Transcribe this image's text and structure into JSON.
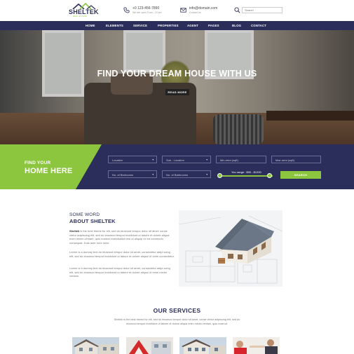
{
  "brand": {
    "name": "SHELTEK",
    "tagline": "REAL ESTATE"
  },
  "header": {
    "phone": {
      "number": "+0 123-456-7890",
      "hours": "We are open 9 am - 10 pm"
    },
    "email": {
      "address": "info@domain.com",
      "note": "Contact us"
    },
    "search_placeholder": "Search"
  },
  "nav": [
    "HOME",
    "ELEMENTS",
    "SERVICE",
    "PROPERTIES",
    "AGENT",
    "PAGES",
    "BLOG",
    "CONTACT"
  ],
  "hero": {
    "title": "FIND YOUR DREAM HOUSE WITH US",
    "button": "READ MORE"
  },
  "find": {
    "title_small": "FIND YOUR",
    "title_big": "HOME HERE",
    "location": "Location",
    "sub_location": "Sub - Location",
    "min_area": "Min area (sqft)",
    "max_area": "Max area (sqft)",
    "bedrooms": "No. of Bedrooms",
    "bathrooms": "No. of Bathrooms",
    "range_label": "You range : $90 - $1200",
    "search_button": "SEARCH",
    "range_low_pct": 0,
    "range_high_pct": 93
  },
  "about": {
    "heading_small": "SOME WORD",
    "heading_big": "ABOUT SHELTEK",
    "brand_in_text": "Sheltek",
    "p1_rest": " is the best theme for elit, sed do eiusmod tempor dolor sit amet, conse ctetur adipiscing elit, sed do eiusmod tempor incididunt ut labore et dolore aliqua enim minim veniam, quis nostrud exercitation nisi ut aliquip ex ea commodo consequat. Duis aute irure dolor.",
    "p2": "Lorem is a dummy text do eiusmod tempor dolor sit amet, consectetur adipi scing elit, sed do eiusmod tempor incididunt ut labore et dolore aliqua Ut enim consectetur.",
    "p3": "Lorem is a dummy text do eiusmod tempor dolor sit amet, consectetur adipi scing elit, sed do eiusmod tempor incididunt ut labore et dolore aliqua Ut enim minim veniam."
  },
  "services": {
    "title": "OUR SERVICES",
    "desc1": "Sheltek is the best theme for elit, sed do eiusmod tempor dolor sit amet, conse ctetur adipiscing elit, sed do",
    "desc2": "eiusmod tempor incididunt ut labore et dolore aliqua enim minim veniam, quis nostrud."
  },
  "colors": {
    "navy": "#2b2e5a",
    "green": "#8cc63f",
    "white": "#ffffff"
  },
  "icons": {
    "phone": "phone-icon",
    "mail": "mail-icon",
    "search": "search-icon"
  }
}
